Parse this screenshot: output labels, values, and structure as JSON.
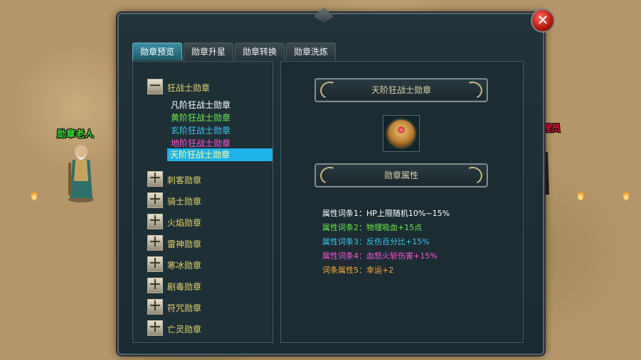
{
  "npcs": {
    "left_name": "勋章老人",
    "right_name": "理员"
  },
  "window": {
    "tabs": [
      {
        "label": "勋章预览",
        "active": true
      },
      {
        "label": "勋章升星",
        "active": false
      },
      {
        "label": "勋章转换",
        "active": false
      },
      {
        "label": "勋章洗炼",
        "active": false
      }
    ],
    "close_icon": "close-icon"
  },
  "tree": {
    "expanded": {
      "label": "狂战士勋章",
      "toggle": "－",
      "children": [
        {
          "label": "凡阶狂战士勋章",
          "color": "#ffffff"
        },
        {
          "label": "黄阶狂战士勋章",
          "color": "#6de84c"
        },
        {
          "label": "玄阶狂战士勋章",
          "color": "#3cc4f0"
        },
        {
          "label": "地阶狂战士勋章",
          "color": "#ff52d9"
        },
        {
          "label": "天阶狂战士勋章",
          "color": "#fffb9a",
          "selected": true
        }
      ]
    },
    "collapsed": [
      {
        "label": "刺客勋章",
        "toggle": "＋"
      },
      {
        "label": "骑士勋章",
        "toggle": "＋"
      },
      {
        "label": "火焰勋章",
        "toggle": "＋"
      },
      {
        "label": "雷神勋章",
        "toggle": "＋"
      },
      {
        "label": "寒冰勋章",
        "toggle": "＋"
      },
      {
        "label": "剧毒勋章",
        "toggle": "＋"
      },
      {
        "label": "符咒勋章",
        "toggle": "＋"
      },
      {
        "label": "亡灵勋章",
        "toggle": "＋"
      }
    ]
  },
  "detail": {
    "title": "天阶狂战士勋章",
    "attr_header": "勋章属性",
    "attributes": [
      {
        "key": "属性词条1：",
        "value": "HP上限随机10%~15%",
        "color": "#ffffff"
      },
      {
        "key": "属性词条2：",
        "value": "物理吸血+15点",
        "color": "#6de84c"
      },
      {
        "key": "属性词条3：",
        "value": "反伤百分比+15%",
        "color": "#3cc4f0"
      },
      {
        "key": "属性词条4：",
        "value": "血怒火斩伤害+15%",
        "color": "#ff52d9"
      },
      {
        "key": "词条属性5：",
        "value": "幸运+2",
        "color": "#ffa63a"
      }
    ]
  },
  "colors": {
    "npc_left_name": "#3ed83a",
    "npc_right_name": "#e0203a",
    "category": "#e0d36a"
  }
}
